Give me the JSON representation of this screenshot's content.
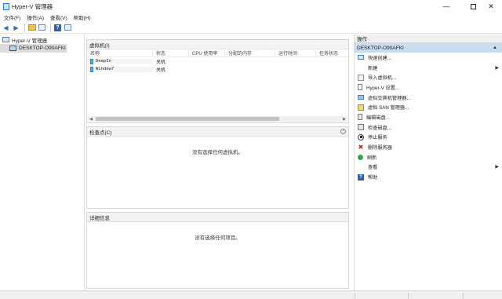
{
  "window": {
    "title": "Hyper-V 管理器",
    "min_glyph": "—",
    "close_glyph": "✕"
  },
  "menu": [
    "文件(F)",
    "操作(A)",
    "查看(V)",
    "帮助(H)"
  ],
  "toolbar": {
    "back_glyph": "◀",
    "forward_glyph": "▶"
  },
  "tree": {
    "root": "Hyper-V 管理器",
    "child": "DESKTOP-O90AFKI"
  },
  "vm_panel": {
    "title": "虚拟机(I)",
    "columns": [
      "名称",
      "状态",
      "CPU 使用率",
      "分配的内存",
      "运行时间",
      "任务状态"
    ],
    "rows": [
      {
        "name": "DeepIn",
        "state": "关机"
      },
      {
        "name": "Window7",
        "state": "关机"
      }
    ],
    "scroll_left": "◀",
    "scroll_right": "▶"
  },
  "checkpoint_panel": {
    "title": "检查点(C)",
    "empty_message": "没有选择任何虚拟机。",
    "collapse_glyph": "⌃"
  },
  "detail_panel": {
    "title": "详细信息",
    "empty_message": "没有选择任何项目。"
  },
  "actions": {
    "header": "操作",
    "section": "DESKTOP-O90AFKI",
    "section_arrow": "▲",
    "items": [
      {
        "label": "快速创建...",
        "icon": "monitor-icon"
      },
      {
        "label": "新建",
        "icon": "blank",
        "submenu": true
      },
      {
        "label": "导入虚拟机...",
        "icon": "import-icon"
      },
      {
        "label": "Hyper-V 设置...",
        "icon": "settings-doc-icon"
      },
      {
        "label": "虚拟交换机管理器...",
        "icon": "switch-icon"
      },
      {
        "label": "虚拟 SAN 管理器...",
        "icon": "san-icon"
      },
      {
        "label": "编辑磁盘...",
        "icon": "edit-disk-icon"
      },
      {
        "label": "检查磁盘...",
        "icon": "inspect-disk-icon"
      },
      {
        "label": "停止服务",
        "icon": "stop-icon"
      },
      {
        "label": "删除服务器",
        "icon": "delete-icon"
      },
      {
        "label": "刷新",
        "icon": "refresh-icon"
      },
      {
        "label": "查看",
        "icon": "blank",
        "submenu": true
      },
      {
        "label": "帮助",
        "icon": "help-icon"
      }
    ],
    "submenu_arrow": "▶",
    "delete_glyph": "✖",
    "help_glyph": "?"
  },
  "colors": {
    "section_bg": "#c9ddf1",
    "selected_tree_bg": "#dcdcdc"
  }
}
